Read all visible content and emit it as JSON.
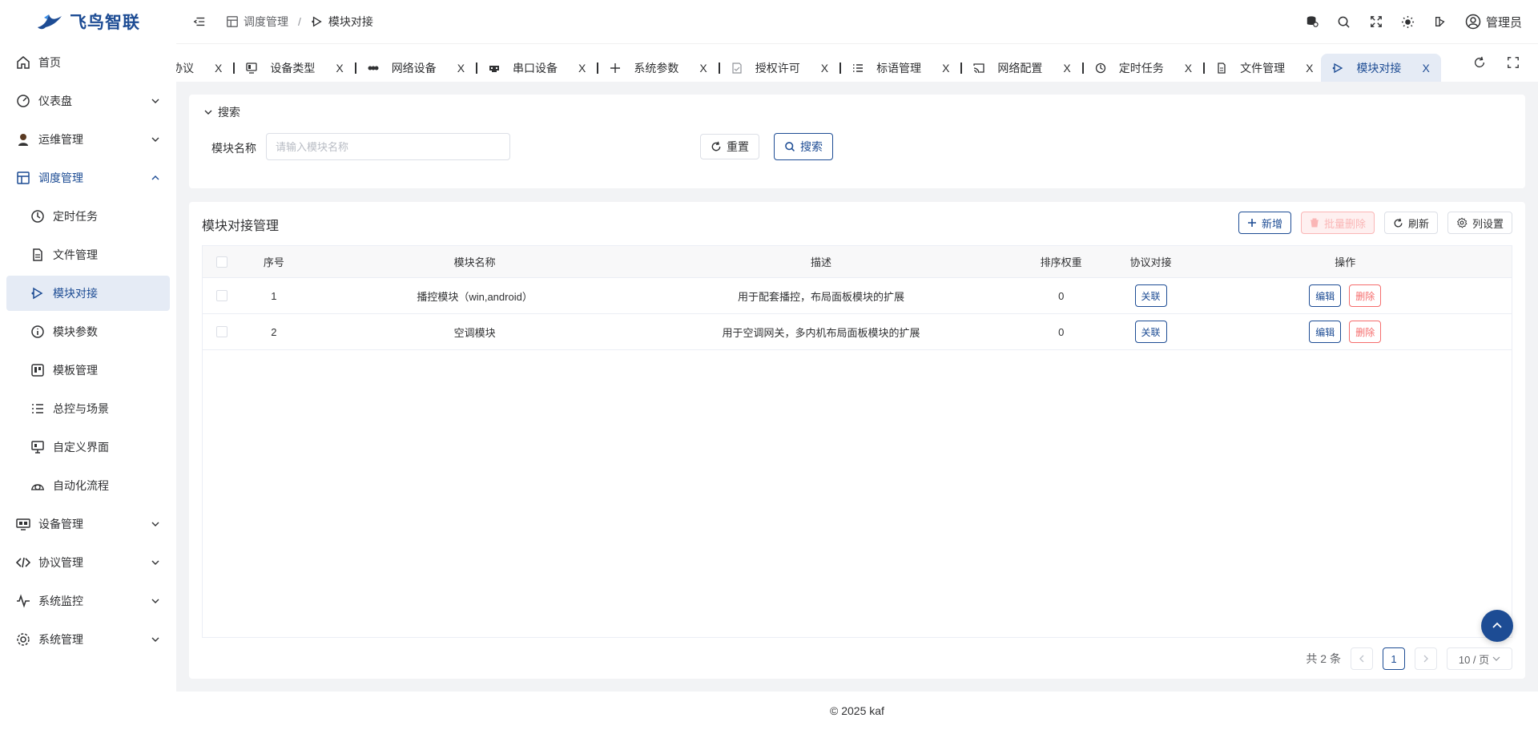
{
  "brand": {
    "name": "飞鸟智联"
  },
  "sidebar": {
    "items": [
      {
        "label": "首页"
      },
      {
        "label": "仪表盘"
      },
      {
        "label": "运维管理"
      },
      {
        "label": "调度管理"
      },
      {
        "label": "设备管理"
      },
      {
        "label": "协议管理"
      },
      {
        "label": "系统监控"
      },
      {
        "label": "系统管理"
      }
    ],
    "submenu": [
      {
        "label": "定时任务"
      },
      {
        "label": "文件管理"
      },
      {
        "label": "模块对接"
      },
      {
        "label": "模块参数"
      },
      {
        "label": "模板管理"
      },
      {
        "label": "总控与场景"
      },
      {
        "label": "自定义界面"
      },
      {
        "label": "自动化流程"
      }
    ]
  },
  "header": {
    "breadcrumb": {
      "parent": "调度管理",
      "separator": "/",
      "current": "模块对接"
    },
    "user": "管理员"
  },
  "tabs": [
    {
      "label": "协议"
    },
    {
      "label": "设备类型"
    },
    {
      "label": "网络设备"
    },
    {
      "label": "串口设备"
    },
    {
      "label": "系统参数"
    },
    {
      "label": "授权许可"
    },
    {
      "label": "标语管理"
    },
    {
      "label": "网络配置"
    },
    {
      "label": "定时任务"
    },
    {
      "label": "文件管理"
    },
    {
      "label": "模块对接"
    }
  ],
  "tab_close": "X",
  "search": {
    "title": "搜索",
    "label": "模块名称",
    "placeholder": "请输入模块名称",
    "value": "",
    "reset_label": "重置",
    "search_label": "搜索"
  },
  "table": {
    "title": "模块对接管理",
    "toolbar": {
      "add": "新增",
      "batch_delete": "批量删除",
      "refresh": "刷新",
      "columns": "列设置"
    },
    "columns": [
      "序号",
      "模块名称",
      "描述",
      "排序权重",
      "协议对接",
      "操作"
    ],
    "rows": [
      {
        "idx": "1",
        "name": "播控模块（win,android）",
        "desc": "用于配套播控，布局面板模块的扩展",
        "sort": "0",
        "proto": "关联",
        "edit": "编辑",
        "del": "删除"
      },
      {
        "idx": "2",
        "name": "空调模块",
        "desc": "用于空调网关，多内机布局面板模块的扩展",
        "sort": "0",
        "proto": "关联",
        "edit": "编辑",
        "del": "删除"
      }
    ]
  },
  "pagination": {
    "total": "共 2 条",
    "page": "1",
    "size": "10 / 页"
  },
  "footer": "© 2025 kaf",
  "colors": {
    "primary": "#1d4c94",
    "danger": "#f56c6c",
    "active_bg": "#e5ebf5"
  }
}
